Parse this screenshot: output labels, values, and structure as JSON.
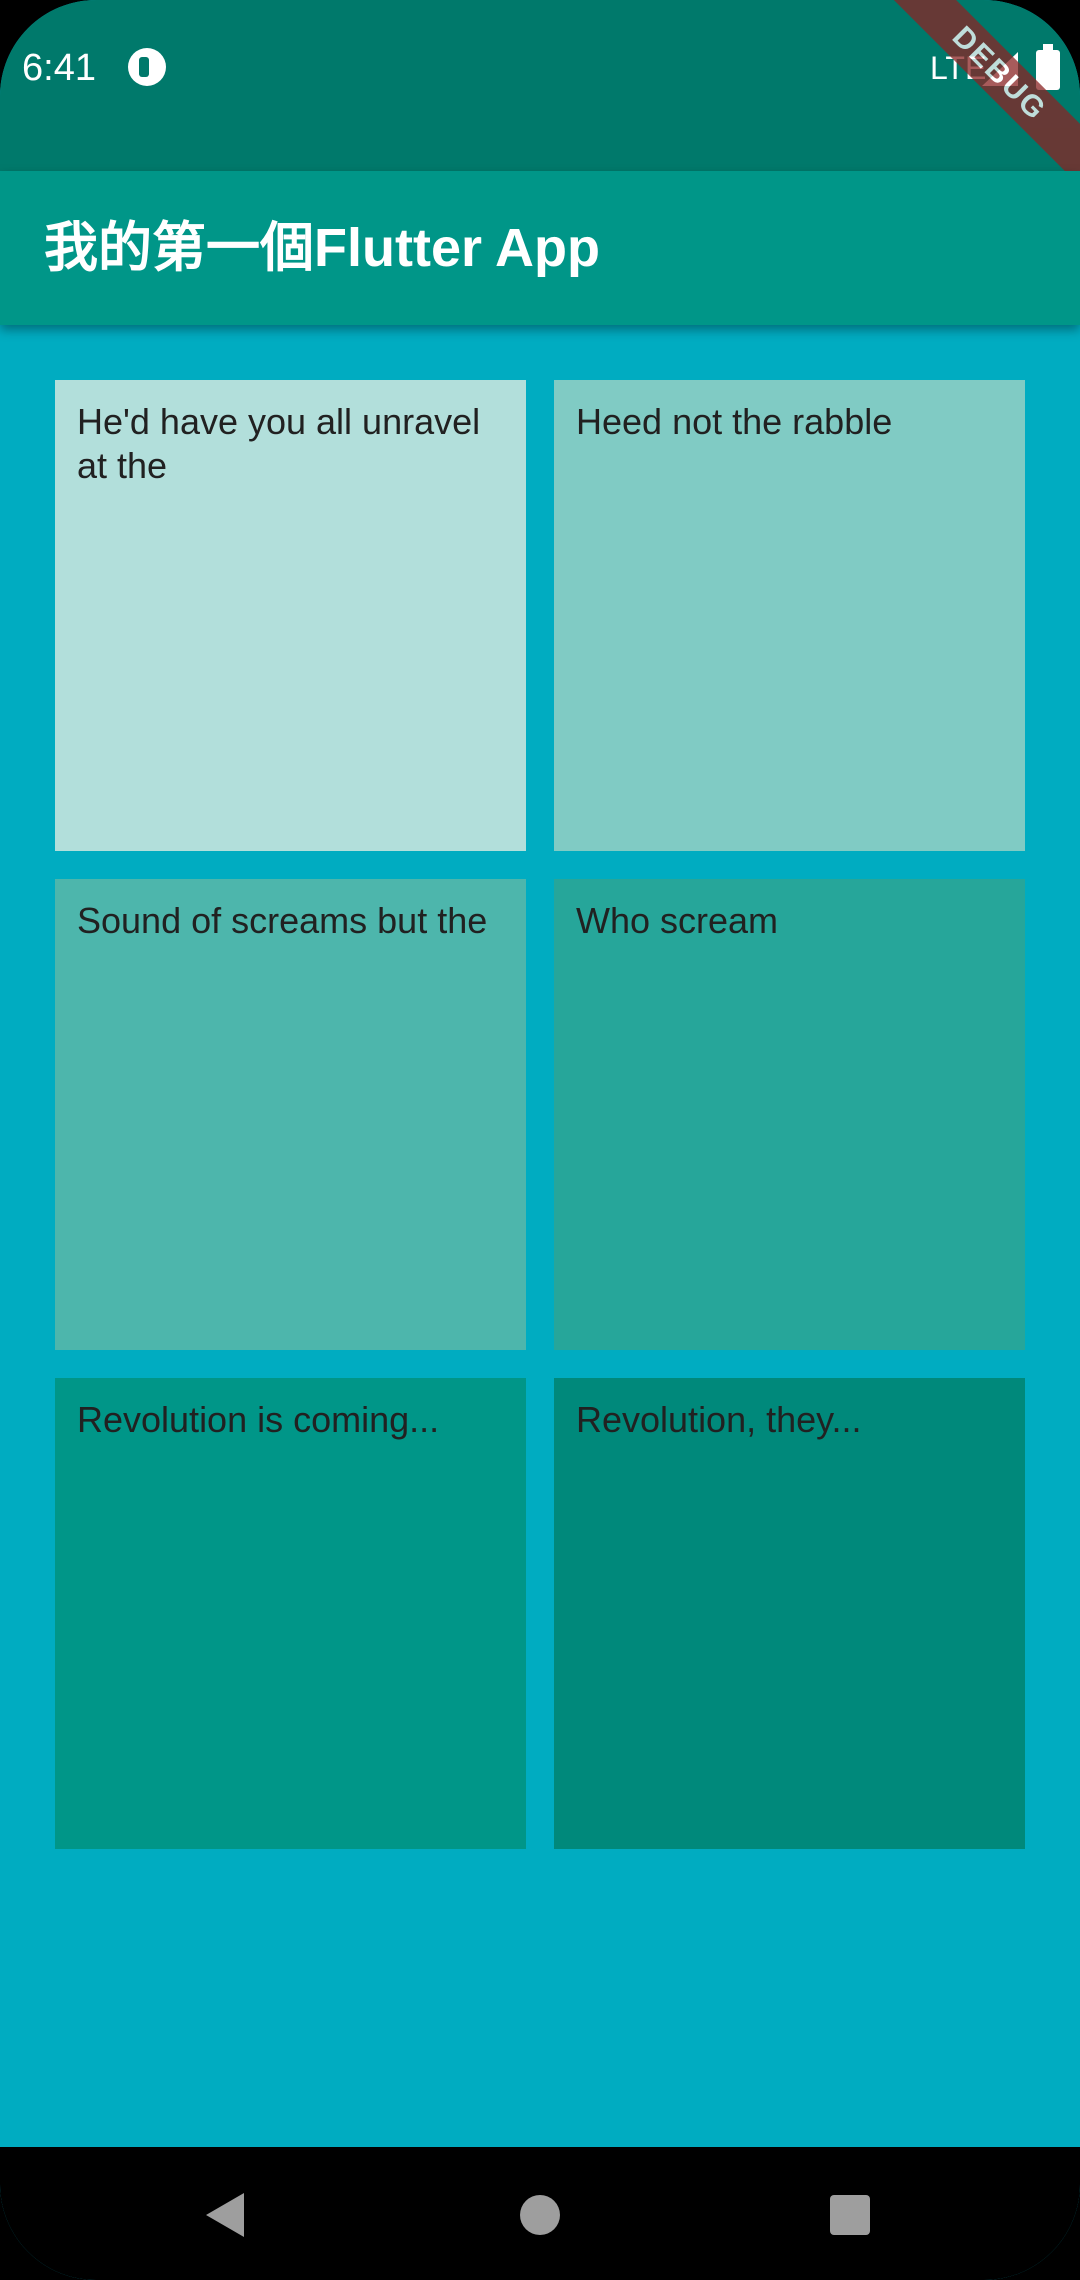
{
  "status_bar": {
    "time": "6:41",
    "network": "LTE",
    "icons": [
      "app-notification-icon",
      "signal-icon",
      "battery-icon"
    ]
  },
  "debug_banner": "DEBUG",
  "app_bar": {
    "title": "我的第一個Flutter App"
  },
  "grid": {
    "items": [
      {
        "text": "He'd have you all unravel at the",
        "color": "#b2dfdb"
      },
      {
        "text": "Heed not the rabble",
        "color": "#80cbc4"
      },
      {
        "text": "Sound of screams but the",
        "color": "#4db6ac"
      },
      {
        "text": "Who scream",
        "color": "#26a69a"
      },
      {
        "text": "Revolution is coming...",
        "color": "#009688"
      },
      {
        "text": "Revolution, they...",
        "color": "#00897b"
      }
    ]
  },
  "colors": {
    "status_bar": "#00796b",
    "app_bar": "#009688",
    "background": "#00acc1",
    "debug_banner": "#8a2424"
  },
  "nav_bar": {
    "icons": [
      "back-icon",
      "home-icon",
      "recents-icon"
    ]
  }
}
